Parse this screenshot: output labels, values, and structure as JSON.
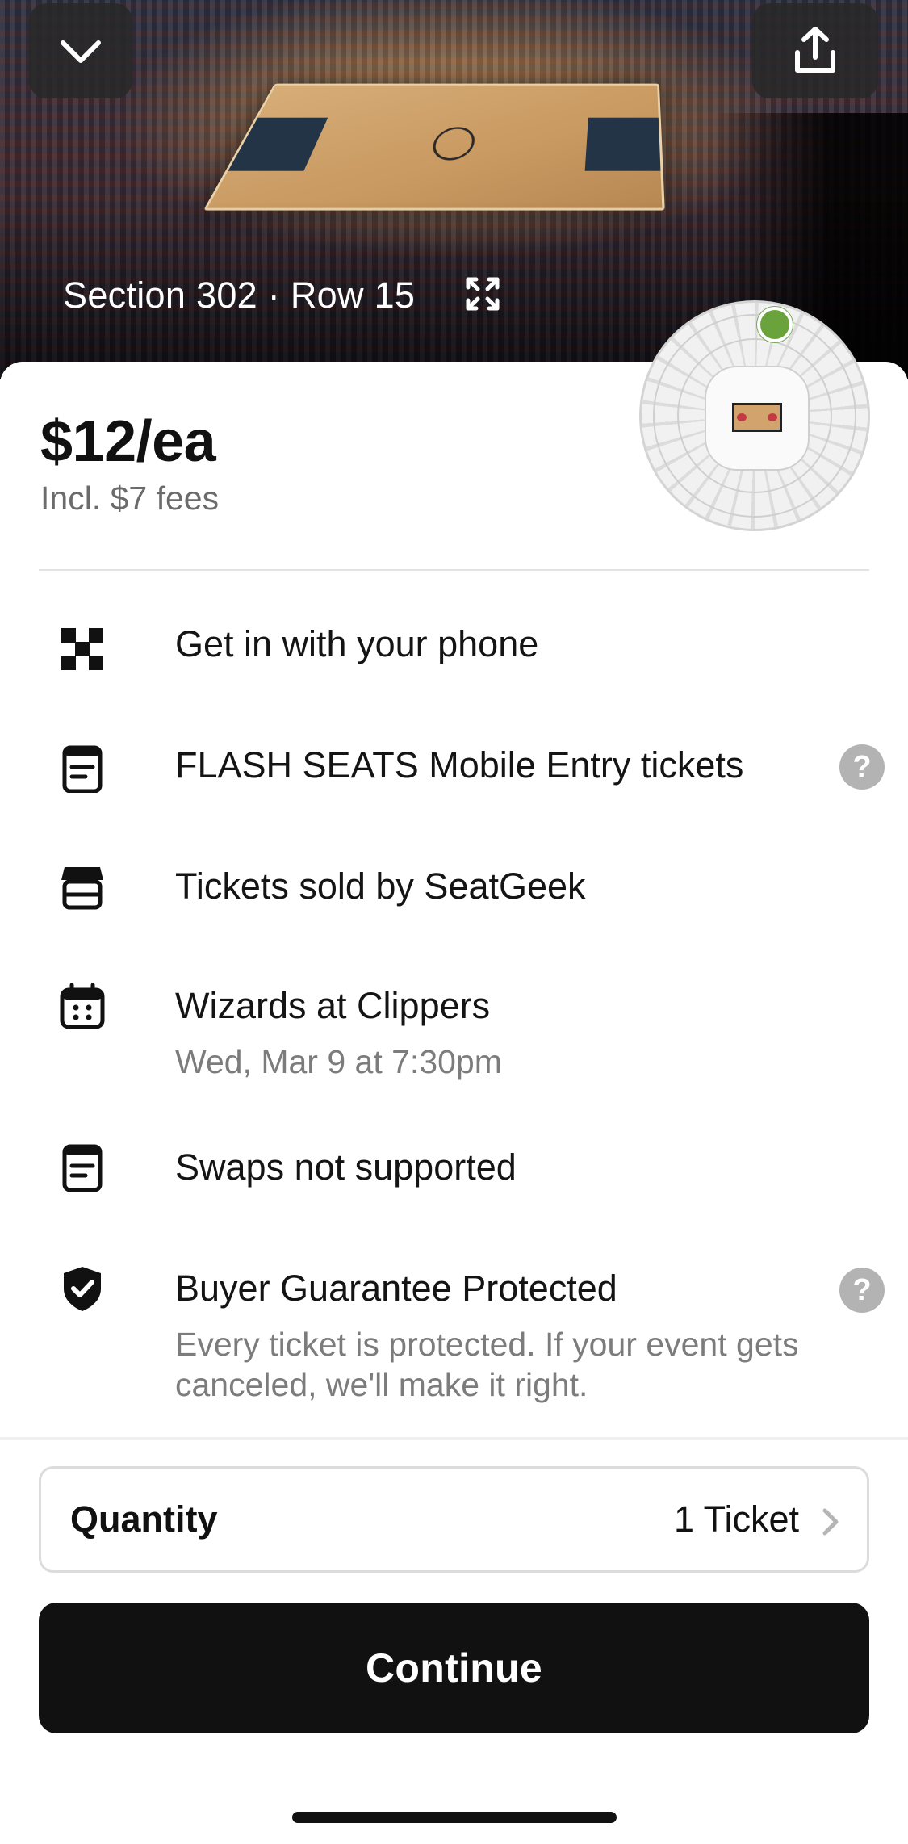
{
  "header": {
    "collapse_icon": "chevron-down-icon",
    "share_icon": "share-icon",
    "seat_location": "Section 302 · Row 15",
    "expand_icon": "expand-icon"
  },
  "listing": {
    "price": "$12/ea",
    "fees": "Incl. $7 fees"
  },
  "details": [
    {
      "icon": "qr-code-icon",
      "title": "Get in with your phone"
    },
    {
      "icon": "ticket-icon",
      "title": "FLASH SEATS Mobile Entry tickets",
      "help": "?"
    },
    {
      "icon": "store-icon",
      "title": "Tickets sold by SeatGeek"
    },
    {
      "icon": "calendar-icon",
      "title": "Wizards at Clippers",
      "subtitle": "Wed, Mar 9 at 7:30pm"
    },
    {
      "icon": "ticket-icon",
      "title": "Swaps not supported"
    },
    {
      "icon": "shield-check-icon",
      "title": "Buyer Guarantee Protected",
      "subtitle_line1": "Every ticket is protected. If your event gets",
      "subtitle_line2": "canceled, we'll make it right.",
      "help": "?"
    }
  ],
  "quantity": {
    "label": "Quantity",
    "value": "1 Ticket"
  },
  "actions": {
    "continue_label": "Continue"
  },
  "colors": {
    "primary_button": "#111111",
    "seat_marker": "#6aa33c",
    "help_badge": "#b3b3b3"
  }
}
